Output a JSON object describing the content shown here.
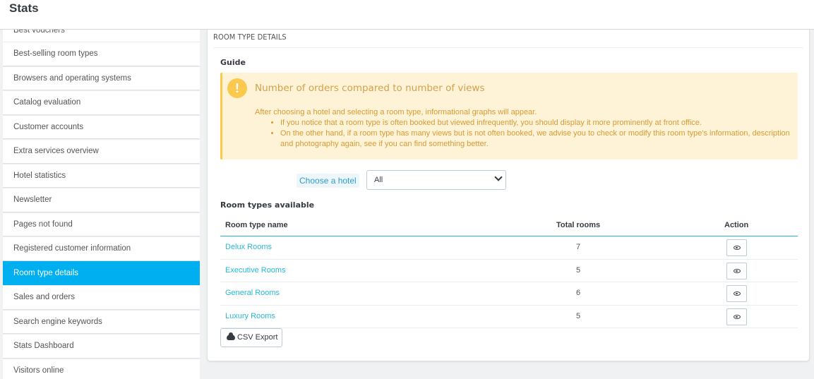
{
  "header": {
    "title": "Stats"
  },
  "sidebar": {
    "items": [
      {
        "label": "Best vouchers",
        "active": false
      },
      {
        "label": "Best-selling room types",
        "active": false
      },
      {
        "label": "Browsers and operating systems",
        "active": false
      },
      {
        "label": "Catalog evaluation",
        "active": false
      },
      {
        "label": "Customer accounts",
        "active": false
      },
      {
        "label": "Extra services overview",
        "active": false
      },
      {
        "label": "Hotel statistics",
        "active": false
      },
      {
        "label": "Newsletter",
        "active": false
      },
      {
        "label": "Pages not found",
        "active": false
      },
      {
        "label": "Registered customer information",
        "active": false
      },
      {
        "label": "Room type details",
        "active": true
      },
      {
        "label": "Sales and orders",
        "active": false
      },
      {
        "label": "Search engine keywords",
        "active": false
      },
      {
        "label": "Stats Dashboard",
        "active": false
      },
      {
        "label": "Visitors online",
        "active": false
      }
    ]
  },
  "panel": {
    "heading": "ROOM TYPE DETAILS",
    "guide_label": "Guide",
    "alert": {
      "icon": "!",
      "title": "Number of orders compared to number of views",
      "intro": "After choosing a hotel and selecting a room type, informational graphs will appear.",
      "bullets": [
        "If you notice that a room type is often booked but viewed infrequently, you should display it more prominently at front office.",
        "On the other hand, if a room type has many views but is not often booked, we advise you to check or modify this room type's information, description and photography again, see if you can find something better."
      ]
    },
    "hotel_label": "Choose a hotel",
    "hotel_select_value": "All",
    "available_label": "Room types available",
    "table": {
      "headers": {
        "name": "Room type name",
        "total": "Total rooms",
        "action": "Action"
      },
      "rows": [
        {
          "name": "Delux Rooms",
          "total": "7"
        },
        {
          "name": "Executive Rooms",
          "total": "5"
        },
        {
          "name": "General Rooms",
          "total": "6"
        },
        {
          "name": "Luxury Rooms",
          "total": "5"
        }
      ]
    },
    "csv_label": "CSV Export"
  },
  "colors": {
    "accent": "#00aff0",
    "link": "#25b9d7",
    "warning_bg": "#fff3d7",
    "warning_text": "#d69b33"
  }
}
